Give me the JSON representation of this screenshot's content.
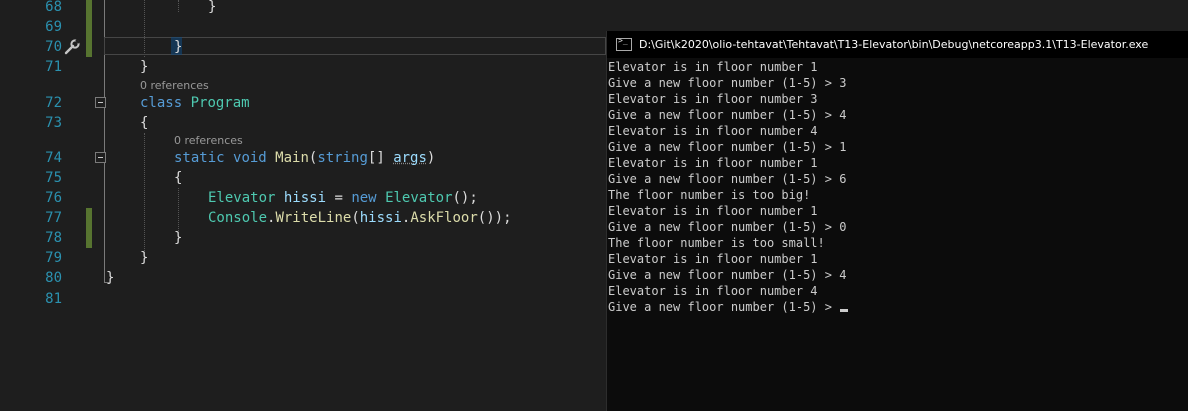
{
  "editor": {
    "line_numbers": [
      "68",
      "69",
      "70",
      "71",
      "72",
      "73",
      "74",
      "75",
      "76",
      "77",
      "78",
      "79",
      "80",
      "81"
    ],
    "codelens": {
      "class_refs": "0 references",
      "method_refs": "0 references"
    },
    "code": {
      "l68": "}",
      "l70": "}",
      "l71": "}",
      "l72_kw": "class",
      "l72_name": "Program",
      "l73": "{",
      "l74_static": "static",
      "l74_void": "void",
      "l74_main": "Main",
      "l74_open": "(",
      "l74_string": "string",
      "l74_brackets": "[] ",
      "l74_args": "args",
      "l74_close": ")",
      "l75": "{",
      "l76_type": "Elevator",
      "l76_sp1": " ",
      "l76_var": "hissi",
      "l76_eq": " = ",
      "l76_new": "new",
      "l76_sp2": " ",
      "l76_ctor": "Elevator",
      "l76_end": "();",
      "l77_console": "Console",
      "l77_dot": ".",
      "l77_writeline": "WriteLine",
      "l77_open": "(",
      "l77_var": "hissi",
      "l77_dot2": ".",
      "l77_askfloor": "AskFloor",
      "l77_end": "());",
      "l78": "}",
      "l79": "}",
      "l80": "}"
    }
  },
  "console": {
    "title": "D:\\Git\\k2020\\olio-tehtavat\\Tehtavat\\T13-Elevator\\bin\\Debug\\netcoreapp3.1\\T13-Elevator.exe",
    "lines": [
      "Elevator is in floor number 1",
      "Give a new floor number (1-5) > 3",
      "Elevator is in floor number 3",
      "Give a new floor number (1-5) > 4",
      "Elevator is in floor number 4",
      "Give a new floor number (1-5) > 1",
      "Elevator is in floor number 1",
      "Give a new floor number (1-5) > 6",
      "The floor number is too big!",
      "Elevator is in floor number 1",
      "Give a new floor number (1-5) > 0",
      "The floor number is too small!",
      "Elevator is in floor number 1",
      "Give a new floor number (1-5) > 4",
      "Elevator is in floor number 4",
      "Give a new floor number (1-5) > "
    ]
  },
  "colors": {
    "editor_bg": "#1e1e1e",
    "line_number": "#2b91af",
    "keyword": "#569cd6",
    "type": "#4ec9b0",
    "method": "#dcdcaa",
    "variable": "#9cdcfe",
    "changed_bar": "#577430",
    "console_bg": "#0c0c0c",
    "console_text": "#cccccc"
  },
  "icons": {
    "gutter": "quick-actions-wrench-icon",
    "console": "console-window-icon"
  }
}
